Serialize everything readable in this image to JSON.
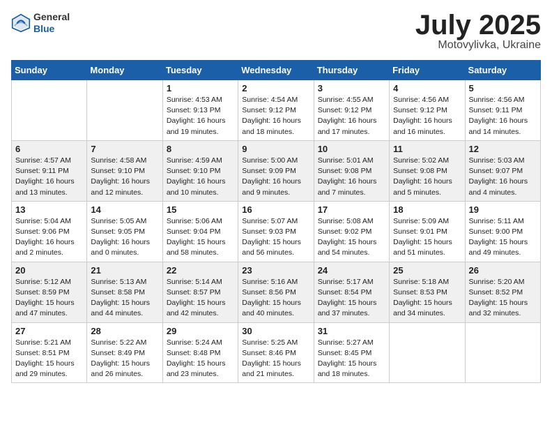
{
  "header": {
    "logo_general": "General",
    "logo_blue": "Blue",
    "month": "July 2025",
    "location": "Motovylivka, Ukraine"
  },
  "weekdays": [
    "Sunday",
    "Monday",
    "Tuesday",
    "Wednesday",
    "Thursday",
    "Friday",
    "Saturday"
  ],
  "weeks": [
    [
      {
        "day": "",
        "sunrise": "",
        "sunset": "",
        "daylight": ""
      },
      {
        "day": "",
        "sunrise": "",
        "sunset": "",
        "daylight": ""
      },
      {
        "day": "1",
        "sunrise": "Sunrise: 4:53 AM",
        "sunset": "Sunset: 9:13 PM",
        "daylight": "Daylight: 16 hours and 19 minutes."
      },
      {
        "day": "2",
        "sunrise": "Sunrise: 4:54 AM",
        "sunset": "Sunset: 9:12 PM",
        "daylight": "Daylight: 16 hours and 18 minutes."
      },
      {
        "day": "3",
        "sunrise": "Sunrise: 4:55 AM",
        "sunset": "Sunset: 9:12 PM",
        "daylight": "Daylight: 16 hours and 17 minutes."
      },
      {
        "day": "4",
        "sunrise": "Sunrise: 4:56 AM",
        "sunset": "Sunset: 9:12 PM",
        "daylight": "Daylight: 16 hours and 16 minutes."
      },
      {
        "day": "5",
        "sunrise": "Sunrise: 4:56 AM",
        "sunset": "Sunset: 9:11 PM",
        "daylight": "Daylight: 16 hours and 14 minutes."
      }
    ],
    [
      {
        "day": "6",
        "sunrise": "Sunrise: 4:57 AM",
        "sunset": "Sunset: 9:11 PM",
        "daylight": "Daylight: 16 hours and 13 minutes."
      },
      {
        "day": "7",
        "sunrise": "Sunrise: 4:58 AM",
        "sunset": "Sunset: 9:10 PM",
        "daylight": "Daylight: 16 hours and 12 minutes."
      },
      {
        "day": "8",
        "sunrise": "Sunrise: 4:59 AM",
        "sunset": "Sunset: 9:10 PM",
        "daylight": "Daylight: 16 hours and 10 minutes."
      },
      {
        "day": "9",
        "sunrise": "Sunrise: 5:00 AM",
        "sunset": "Sunset: 9:09 PM",
        "daylight": "Daylight: 16 hours and 9 minutes."
      },
      {
        "day": "10",
        "sunrise": "Sunrise: 5:01 AM",
        "sunset": "Sunset: 9:08 PM",
        "daylight": "Daylight: 16 hours and 7 minutes."
      },
      {
        "day": "11",
        "sunrise": "Sunrise: 5:02 AM",
        "sunset": "Sunset: 9:08 PM",
        "daylight": "Daylight: 16 hours and 5 minutes."
      },
      {
        "day": "12",
        "sunrise": "Sunrise: 5:03 AM",
        "sunset": "Sunset: 9:07 PM",
        "daylight": "Daylight: 16 hours and 4 minutes."
      }
    ],
    [
      {
        "day": "13",
        "sunrise": "Sunrise: 5:04 AM",
        "sunset": "Sunset: 9:06 PM",
        "daylight": "Daylight: 16 hours and 2 minutes."
      },
      {
        "day": "14",
        "sunrise": "Sunrise: 5:05 AM",
        "sunset": "Sunset: 9:05 PM",
        "daylight": "Daylight: 16 hours and 0 minutes."
      },
      {
        "day": "15",
        "sunrise": "Sunrise: 5:06 AM",
        "sunset": "Sunset: 9:04 PM",
        "daylight": "Daylight: 15 hours and 58 minutes."
      },
      {
        "day": "16",
        "sunrise": "Sunrise: 5:07 AM",
        "sunset": "Sunset: 9:03 PM",
        "daylight": "Daylight: 15 hours and 56 minutes."
      },
      {
        "day": "17",
        "sunrise": "Sunrise: 5:08 AM",
        "sunset": "Sunset: 9:02 PM",
        "daylight": "Daylight: 15 hours and 54 minutes."
      },
      {
        "day": "18",
        "sunrise": "Sunrise: 5:09 AM",
        "sunset": "Sunset: 9:01 PM",
        "daylight": "Daylight: 15 hours and 51 minutes."
      },
      {
        "day": "19",
        "sunrise": "Sunrise: 5:11 AM",
        "sunset": "Sunset: 9:00 PM",
        "daylight": "Daylight: 15 hours and 49 minutes."
      }
    ],
    [
      {
        "day": "20",
        "sunrise": "Sunrise: 5:12 AM",
        "sunset": "Sunset: 8:59 PM",
        "daylight": "Daylight: 15 hours and 47 minutes."
      },
      {
        "day": "21",
        "sunrise": "Sunrise: 5:13 AM",
        "sunset": "Sunset: 8:58 PM",
        "daylight": "Daylight: 15 hours and 44 minutes."
      },
      {
        "day": "22",
        "sunrise": "Sunrise: 5:14 AM",
        "sunset": "Sunset: 8:57 PM",
        "daylight": "Daylight: 15 hours and 42 minutes."
      },
      {
        "day": "23",
        "sunrise": "Sunrise: 5:16 AM",
        "sunset": "Sunset: 8:56 PM",
        "daylight": "Daylight: 15 hours and 40 minutes."
      },
      {
        "day": "24",
        "sunrise": "Sunrise: 5:17 AM",
        "sunset": "Sunset: 8:54 PM",
        "daylight": "Daylight: 15 hours and 37 minutes."
      },
      {
        "day": "25",
        "sunrise": "Sunrise: 5:18 AM",
        "sunset": "Sunset: 8:53 PM",
        "daylight": "Daylight: 15 hours and 34 minutes."
      },
      {
        "day": "26",
        "sunrise": "Sunrise: 5:20 AM",
        "sunset": "Sunset: 8:52 PM",
        "daylight": "Daylight: 15 hours and 32 minutes."
      }
    ],
    [
      {
        "day": "27",
        "sunrise": "Sunrise: 5:21 AM",
        "sunset": "Sunset: 8:51 PM",
        "daylight": "Daylight: 15 hours and 29 minutes."
      },
      {
        "day": "28",
        "sunrise": "Sunrise: 5:22 AM",
        "sunset": "Sunset: 8:49 PM",
        "daylight": "Daylight: 15 hours and 26 minutes."
      },
      {
        "day": "29",
        "sunrise": "Sunrise: 5:24 AM",
        "sunset": "Sunset: 8:48 PM",
        "daylight": "Daylight: 15 hours and 23 minutes."
      },
      {
        "day": "30",
        "sunrise": "Sunrise: 5:25 AM",
        "sunset": "Sunset: 8:46 PM",
        "daylight": "Daylight: 15 hours and 21 minutes."
      },
      {
        "day": "31",
        "sunrise": "Sunrise: 5:27 AM",
        "sunset": "Sunset: 8:45 PM",
        "daylight": "Daylight: 15 hours and 18 minutes."
      },
      {
        "day": "",
        "sunrise": "",
        "sunset": "",
        "daylight": ""
      },
      {
        "day": "",
        "sunrise": "",
        "sunset": "",
        "daylight": ""
      }
    ]
  ]
}
